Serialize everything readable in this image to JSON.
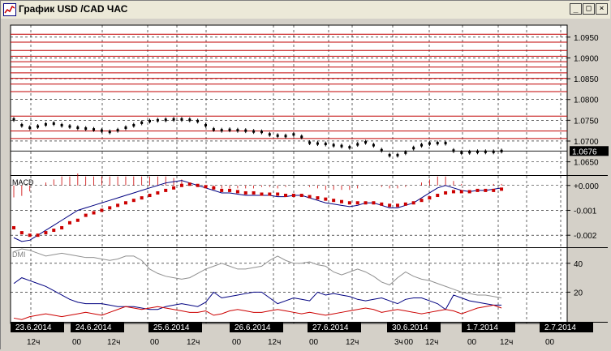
{
  "window": {
    "title": "График USD /CAD  ЧАС",
    "minimize_icon": "minimize-icon",
    "maximize_icon": "maximize-icon",
    "close_icon": "close-icon",
    "minimize_glyph": "_",
    "maximize_glyph": "□",
    "close_glyph": "×"
  },
  "colors": {
    "background": "#ffffff",
    "grid": "#000000",
    "resistance_lines": "#c00000",
    "macd_signal": "#cc0000",
    "macd_line": "#000080",
    "dmi_adx": "#909090",
    "dmi_plus": "#000080",
    "dmi_minus": "#cc0000",
    "label_bg": "#000000",
    "label_fg": "#ffffff"
  },
  "price_panel": {
    "ticks": [
      "1.0950",
      "1.0900",
      "1.0850",
      "1.0800",
      "1.0750",
      "1.0700",
      "1.0650"
    ],
    "current_price": "1.0676",
    "ylim": [
      1.062,
      1.0975
    ],
    "resistance_levels": [
      1.0957,
      1.0938,
      1.0918,
      1.0904,
      1.0891,
      1.0878,
      1.0864,
      1.0851,
      1.0837,
      1.0819,
      1.076,
      1.0724,
      1.0706
    ]
  },
  "macd_panel": {
    "label": "MACD",
    "ticks": [
      "+0.000",
      "-0.001",
      "-0.002"
    ],
    "ylim": [
      -0.00245,
      0.00035
    ]
  },
  "dmi_panel": {
    "label": "DMI",
    "ticks": [
      "40",
      "20"
    ],
    "ylim": [
      0,
      50
    ]
  },
  "time_axis": {
    "date_labels": [
      "23.6.2014",
      "24.6.2014",
      "25.6.2014",
      "26.6.2014",
      "27.6.2014",
      "30.6.2014",
      "1.7.2014",
      "2.7.2014"
    ],
    "hour_labels": [
      "12ч",
      "00",
      "12ч",
      "00",
      "12ч",
      "00",
      "12ч",
      "00",
      "12ч",
      "3ч",
      "00",
      "12ч",
      "00",
      "12ч",
      "00"
    ]
  },
  "chart_data": [
    {
      "type": "line",
      "title": "График USD /CAD  ЧАС",
      "x": [
        0,
        10,
        20,
        30,
        40,
        50,
        60,
        70,
        80,
        90,
        100,
        110,
        120,
        130,
        140,
        150,
        160,
        170,
        180,
        190,
        200,
        210,
        220,
        230,
        240,
        250,
        260,
        270,
        280,
        290,
        300,
        310,
        320,
        330,
        340,
        350,
        360,
        370,
        380,
        390,
        400,
        410,
        420,
        430,
        440,
        450,
        460,
        470,
        480,
        490,
        500,
        510,
        520,
        530,
        540,
        550,
        560,
        570,
        580,
        590,
        600,
        610
      ],
      "series": [
        {
          "values": [
            1.0752,
            1.0738,
            1.0732,
            1.0735,
            1.074,
            1.0742,
            1.0738,
            1.0735,
            1.0732,
            1.073,
            1.0728,
            1.0725,
            1.0722,
            1.0726,
            1.0732,
            1.0738,
            1.0744,
            1.0748,
            1.075,
            1.0751,
            1.0752,
            1.0752,
            1.0751,
            1.0748,
            1.0738,
            1.0728,
            1.0726,
            1.0727,
            1.0726,
            1.0725,
            1.0723,
            1.0722,
            1.0716,
            1.0713,
            1.0712,
            1.0716,
            1.071,
            1.0696,
            1.0694,
            1.0693,
            1.069,
            1.0688,
            1.0685,
            1.0692,
            1.0697,
            1.069,
            1.0678,
            1.0666,
            1.0666,
            1.0672,
            1.0683,
            1.069,
            1.0694,
            1.0695,
            1.0695,
            1.0677,
            1.0672,
            1.0673,
            1.0674,
            1.0674,
            1.0674,
            1.0676
          ]
        }
      ],
      "ylim": [
        1.062,
        1.0975
      ]
    },
    {
      "type": "line",
      "title": "MACD",
      "x": [
        0,
        10,
        20,
        30,
        40,
        50,
        60,
        70,
        80,
        90,
        100,
        110,
        120,
        130,
        140,
        150,
        160,
        170,
        180,
        190,
        200,
        210,
        220,
        230,
        240,
        250,
        260,
        270,
        280,
        290,
        300,
        310,
        320,
        330,
        340,
        350,
        360,
        370,
        380,
        390,
        400,
        410,
        420,
        430,
        440,
        450,
        460,
        470,
        480,
        490,
        500,
        510,
        520,
        530,
        540,
        550,
        560,
        570,
        580,
        590,
        600,
        610
      ],
      "series": [
        {
          "values": [
            -0.0021,
            -0.00225,
            -0.0022,
            -0.002,
            -0.0018,
            -0.0016,
            -0.0014,
            -0.0012,
            -0.001,
            -0.0009,
            -0.0008,
            -0.0007,
            -0.0006,
            -0.0005,
            -0.0004,
            -0.0003,
            -0.0002,
            -0.0001,
            0.0,
            0.0001,
            0.00015,
            0.0002,
            0.0001,
            0.0,
            -0.0001,
            -0.0002,
            -0.0003,
            -0.0003,
            -0.00035,
            -0.0004,
            -0.0004,
            -0.0004,
            -0.0004,
            -0.00045,
            -0.00045,
            -0.0004,
            -0.0004,
            -0.0005,
            -0.0006,
            -0.0007,
            -0.00075,
            -0.0008,
            -0.00085,
            -0.0008,
            -0.0007,
            -0.0007,
            -0.0008,
            -0.0009,
            -0.0009,
            -0.0008,
            -0.0007,
            -0.0005,
            -0.0003,
            -0.0001,
            0.0,
            -0.0001,
            -0.0002,
            -0.00025,
            -0.0002,
            -0.0002,
            -0.00015,
            -0.0001
          ]
        },
        {
          "values": [
            -0.0017,
            -0.0019,
            -0.002,
            -0.002,
            -0.0019,
            -0.0018,
            -0.0017,
            -0.0015,
            -0.0014,
            -0.0012,
            -0.0011,
            -0.001,
            -0.0009,
            -0.0008,
            -0.0007,
            -0.0006,
            -0.0005,
            -0.0004,
            -0.0003,
            -0.0002,
            -0.0001,
            0.0,
            5e-05,
            0.0,
            -5e-05,
            -0.0001,
            -0.0002,
            -0.0002,
            -0.00025,
            -0.0003,
            -0.0003,
            -0.00035,
            -0.00035,
            -0.00035,
            -0.0004,
            -0.0004,
            -0.0004,
            -0.00045,
            -0.0005,
            -0.00055,
            -0.0006,
            -0.00065,
            -0.0007,
            -0.0007,
            -0.0007,
            -0.0007,
            -0.00075,
            -0.0008,
            -0.0008,
            -0.00075,
            -0.0007,
            -0.0006,
            -0.0005,
            -0.0004,
            -0.0003,
            -0.00025,
            -0.00025,
            -0.00025,
            -0.0002,
            -0.0002,
            -0.0002,
            -0.00015
          ]
        }
      ],
      "ylim": [
        -0.00245,
        0.00035
      ]
    },
    {
      "type": "line",
      "title": "DMI",
      "x": [
        0,
        10,
        20,
        30,
        40,
        50,
        60,
        70,
        80,
        90,
        100,
        110,
        120,
        130,
        140,
        150,
        160,
        170,
        180,
        190,
        200,
        210,
        220,
        230,
        240,
        250,
        260,
        270,
        280,
        290,
        300,
        310,
        320,
        330,
        340,
        350,
        360,
        370,
        380,
        390,
        400,
        410,
        420,
        430,
        440,
        450,
        460,
        470,
        480,
        490,
        500,
        510,
        520,
        530,
        540,
        550,
        560,
        570,
        580,
        590,
        600,
        610
      ],
      "series": [
        {
          "values": [
            48,
            50,
            49,
            47,
            45,
            46,
            47,
            46,
            45,
            44,
            44,
            43,
            42,
            43,
            45,
            45,
            42,
            36,
            33,
            31,
            30,
            29,
            30,
            33,
            36,
            38,
            40,
            38,
            36,
            36,
            37,
            38,
            42,
            45,
            42,
            40,
            40,
            41,
            39,
            38,
            34,
            32,
            34,
            36,
            34,
            31,
            27,
            25,
            30,
            34,
            31,
            29,
            28,
            26,
            24,
            22,
            20,
            19,
            18,
            18,
            17,
            16
          ]
        },
        {
          "values": [
            26,
            30,
            28,
            26,
            24,
            21,
            18,
            15,
            13,
            12,
            12,
            12,
            11,
            10,
            10,
            10,
            9,
            8,
            8,
            10,
            11,
            12,
            11,
            10,
            13,
            20,
            16,
            17,
            18,
            19,
            20,
            20,
            16,
            12,
            14,
            16,
            15,
            14,
            20,
            18,
            19,
            18,
            17,
            15,
            14,
            15,
            16,
            14,
            12,
            15,
            16,
            16,
            14,
            12,
            8,
            18,
            16,
            14,
            13,
            12,
            11,
            11
          ]
        },
        {
          "values": [
            2,
            1,
            3,
            4,
            5,
            4,
            3,
            4,
            5,
            6,
            5,
            4,
            6,
            8,
            10,
            9,
            8,
            9,
            10,
            9,
            8,
            7,
            6,
            6,
            7,
            4,
            5,
            7,
            8,
            7,
            6,
            6,
            7,
            8,
            7,
            6,
            5,
            6,
            5,
            4,
            5,
            6,
            7,
            8,
            9,
            8,
            6,
            7,
            8,
            7,
            6,
            5,
            6,
            7,
            8,
            7,
            5,
            7,
            9,
            10,
            11,
            9
          ]
        }
      ],
      "ylim": [
        0,
        50
      ]
    }
  ]
}
